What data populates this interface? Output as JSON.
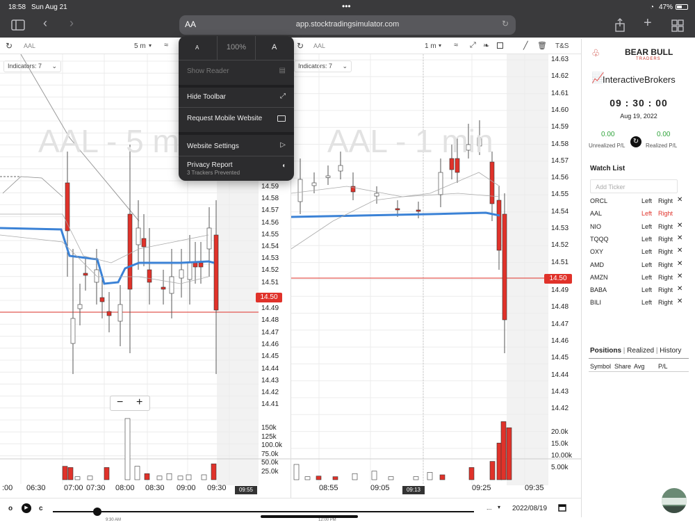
{
  "status": {
    "time": "18:58",
    "date": "Sun Aug 21",
    "battery": "47%"
  },
  "safari": {
    "aa_label": "AA",
    "url": "app.stocktradingsimulator.com",
    "dots": "•••"
  },
  "aa_menu": {
    "small_a": "A",
    "zoom": "100%",
    "large_a": "A",
    "items": [
      {
        "label": "Show Reader",
        "disabled": true
      },
      {
        "label": "Hide Toolbar"
      },
      {
        "label": "Request Mobile Website"
      },
      {
        "label": "Website Settings"
      },
      {
        "label": "Privacy Report",
        "sublabel": "3 Trackers Prevented"
      }
    ]
  },
  "left_chart": {
    "symbol": "AAL",
    "interval": "5 m",
    "indicators": "Indicators: 7",
    "watermark": "AAL - 5 m",
    "price_labels": [
      "14.59",
      "14.58",
      "14.57",
      "14.56",
      "14.55",
      "14.54",
      "14.53",
      "14.52",
      "14.51",
      "14.49",
      "14.48",
      "14.47",
      "14.46",
      "14.45",
      "14.44",
      "14.43",
      "14.42",
      "14.41"
    ],
    "current_price": "14.50",
    "volume_labels": [
      "150k",
      "125k",
      "100.0k",
      "75.0k",
      "50.0k",
      "25.0k"
    ],
    "time_labels": [
      ":00",
      "06:30",
      "07:00",
      "07:30",
      "08:00",
      "08:30",
      "09:00",
      "09:30"
    ],
    "cursor_time": "09:55",
    "zoom_minus": "−",
    "zoom_plus": "+"
  },
  "right_chart": {
    "symbol": "AAL",
    "interval": "1 m",
    "indicators": "Indicators: 7",
    "watermark": "AAL - 1 min",
    "ts_label": "T&S",
    "price_labels": [
      "14.63",
      "14.62",
      "14.61",
      "14.60",
      "14.59",
      "14.58",
      "14.57",
      "14.56",
      "14.55",
      "14.54",
      "14.53",
      "14.52",
      "14.51",
      "14.49",
      "14.48",
      "14.47",
      "14.46",
      "14.45",
      "14.44",
      "14.43",
      "14.42"
    ],
    "current_price": "14.50",
    "volume_labels": [
      "20.0k",
      "15.0k",
      "10.00k",
      "5.00k"
    ],
    "time_labels": [
      "08:55",
      "09:05",
      "09:25",
      "09:35"
    ],
    "cursor_time": "09:13"
  },
  "right_panel": {
    "brand1": "BEAR BULL",
    "brand1_sub": "TRADERS",
    "brand2": "InteractiveBrokers",
    "clock": "09 : 30 : 00",
    "date": "Aug 19, 2022",
    "unrealized_value": "0.00",
    "unrealized_label": "Unrealized P/L",
    "realized_value": "0.00",
    "realized_label": "Realized P/L",
    "watchlist_title": "Watch List",
    "add_placeholder": "Add Ticker",
    "watchlist": [
      {
        "ticker": "ORCL",
        "left": "Left",
        "right": "Right",
        "active": false
      },
      {
        "ticker": "AAL",
        "left": "Left",
        "right": "Right",
        "active": true
      },
      {
        "ticker": "NIO",
        "left": "Left",
        "right": "Right",
        "active": false
      },
      {
        "ticker": "TQQQ",
        "left": "Left",
        "right": "Right",
        "active": false
      },
      {
        "ticker": "OXY",
        "left": "Left",
        "right": "Right",
        "active": false
      },
      {
        "ticker": "AMD",
        "left": "Left",
        "right": "Right",
        "active": false
      },
      {
        "ticker": "AMZN",
        "left": "Left",
        "right": "Right",
        "active": false
      },
      {
        "ticker": "BABA",
        "left": "Left",
        "right": "Right",
        "active": false
      },
      {
        "ticker": "BILI",
        "left": "Left",
        "right": "Right",
        "active": false
      }
    ],
    "tabs": [
      "Positions",
      "Realized",
      "History"
    ],
    "columns": [
      "Symbol",
      "Share",
      "Avg",
      "P/L"
    ]
  },
  "playback": {
    "btn_o": "o",
    "btn_c": "c",
    "more": "...",
    "date": "2022/08/19",
    "start_time": "9:30 AM",
    "mid_time": "12:00 PM"
  },
  "colors": {
    "up": "#ffffff",
    "down": "#e0322a",
    "vwap": "#3b82d6",
    "price_tag": "#e0322a"
  }
}
